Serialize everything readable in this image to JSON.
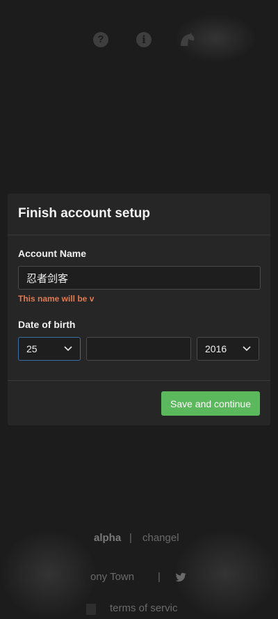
{
  "top_icons": {
    "help": "?",
    "info": "i",
    "help_icon": "question-circle-icon",
    "info_icon": "info-circle-icon",
    "pony_icon": "pony-head-icon"
  },
  "modal": {
    "title": "Finish account setup",
    "account_name_label": "Account Name",
    "account_name_value": "忍者剑客",
    "warning": "This name will be v",
    "dob_label": "Date of birth",
    "day_value": "25",
    "month_value": "",
    "year_value": "2016",
    "submit_label": "Save and continue"
  },
  "footer": {
    "version": "alpha",
    "separator": "|",
    "changelog": "changel",
    "pony_town": "ony Town",
    "tos": "terms of servic"
  },
  "colors": {
    "background": "#1c1c1c",
    "panel": "#262626",
    "warning": "#e07a52",
    "primary_button": "#5cb85c",
    "focus_border": "#3d6fa6"
  }
}
